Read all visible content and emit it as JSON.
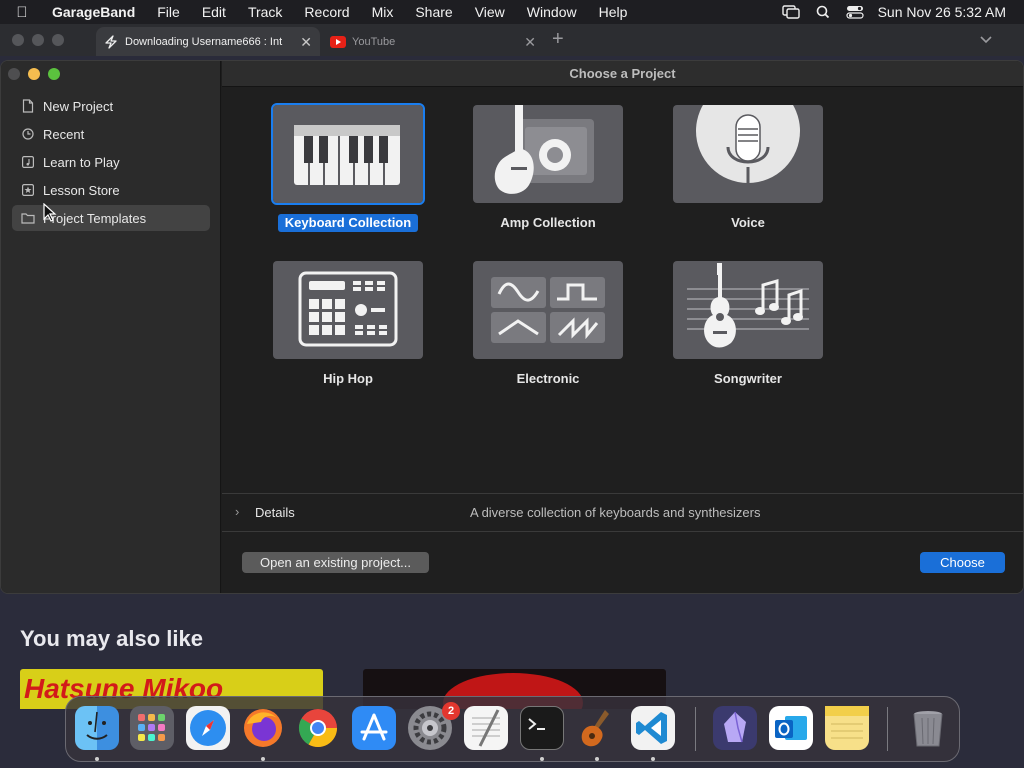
{
  "menubar": {
    "app": "GarageBand",
    "items": [
      "File",
      "Edit",
      "Track",
      "Record",
      "Mix",
      "Share",
      "View",
      "Window",
      "Help"
    ],
    "datetime": "Sun Nov 26  5:32 AM"
  },
  "browser": {
    "tabs": [
      {
        "title": "Downloading Username666 : Int",
        "icon": "bolt-icon",
        "active": true
      },
      {
        "title": "YouTube",
        "icon": "youtube-icon",
        "active": false
      }
    ]
  },
  "window": {
    "title": "Choose a Project",
    "sidebar": [
      {
        "label": "New Project",
        "icon": "document-icon"
      },
      {
        "label": "Recent",
        "icon": "clock-icon"
      },
      {
        "label": "Learn to Play",
        "icon": "music-note-icon"
      },
      {
        "label": "Lesson Store",
        "icon": "star-icon"
      },
      {
        "label": "Project Templates",
        "icon": "folder-icon",
        "selected": true
      }
    ],
    "templates": [
      {
        "label": "Keyboard Collection",
        "icon": "keyboard-icon",
        "selected": true
      },
      {
        "label": "Amp Collection",
        "icon": "guitar-amp-icon"
      },
      {
        "label": "Voice",
        "icon": "microphone-icon"
      },
      {
        "label": "Hip Hop",
        "icon": "drum-machine-icon"
      },
      {
        "label": "Electronic",
        "icon": "waveforms-icon"
      },
      {
        "label": "Songwriter",
        "icon": "acoustic-guitar-icon"
      }
    ],
    "details_label": "Details",
    "details_desc": "A diverse collection of keyboards and synthesizers",
    "open_button": "Open an existing project...",
    "choose_button": "Choose"
  },
  "store": {
    "heading": "You may also like",
    "thumb1_text": "Hatsune Mikoo"
  },
  "dock": {
    "apps": [
      "Finder",
      "Launchpad",
      "Safari",
      "Firefox",
      "Chrome",
      "App Store",
      "System Settings",
      "TextEdit",
      "Terminal",
      "GarageBand",
      "Visual Studio Code",
      "Obsidian",
      "Outlook",
      "Notes",
      "Trash"
    ],
    "settings_badge": "2"
  },
  "colors": {
    "accent": "#1a6fd8",
    "window_bg": "#1f1f1f",
    "sidebar_bg": "#2b2b2b"
  }
}
